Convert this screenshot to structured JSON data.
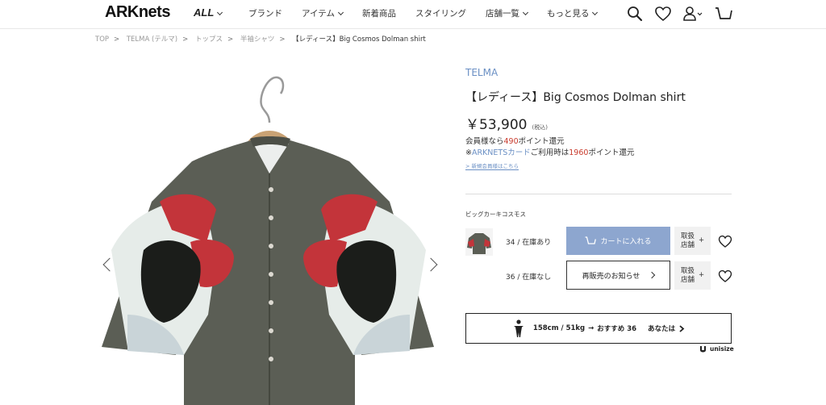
{
  "header": {
    "logo": "ARKnets",
    "all_menu": "ALL",
    "nav": [
      "ブランド",
      "アイテム",
      "新着商品",
      "スタイリング",
      "店舗一覧",
      "もっと見る"
    ],
    "nav_has_dropdown": [
      false,
      true,
      false,
      false,
      true,
      true
    ]
  },
  "breadcrumb": [
    "TOP",
    "TELMA (テルマ)",
    "トップス",
    "半袖シャツ",
    "【レディース】Big Cosmos Dolman shirt"
  ],
  "product": {
    "brand": "TELMA",
    "title": "【レディース】Big Cosmos Dolman shirt",
    "price": "￥53,900",
    "tax_note": "(税込)",
    "points_line1_prefix": "会員様なら",
    "points_line1_value": "490",
    "points_line1_suffix": "ポイント還元",
    "points_line2_prefix": "※",
    "points_line2_card": "ARKNETSカード",
    "points_line2_mid": "ご利用時は",
    "points_line2_value": "1960",
    "points_line2_suffix": "ポイント還元",
    "register_link": "新規会員様はこちら",
    "color_name": "ビッグカーキコスモス"
  },
  "variants": [
    {
      "size_stock": "34 / 在庫あり",
      "action": "カートに入れる",
      "store": "取扱店舗",
      "store_plus": "+"
    },
    {
      "size_stock": "36 / 在庫なし",
      "action": "再販売のお知らせ",
      "store": "取扱店舗",
      "store_plus": "+"
    }
  ],
  "size_recommend": {
    "body": "158cm / 51kg",
    "arrow": "→",
    "recommend": "おすすめ 36",
    "you": "あなたは"
  },
  "unisize_label": "unisize",
  "colors": {
    "accent_blue": "#6a8fc4",
    "cart_button": "#8da6cf",
    "point_red": "#c8392b",
    "shirt_khaki": "#5b5e55"
  }
}
